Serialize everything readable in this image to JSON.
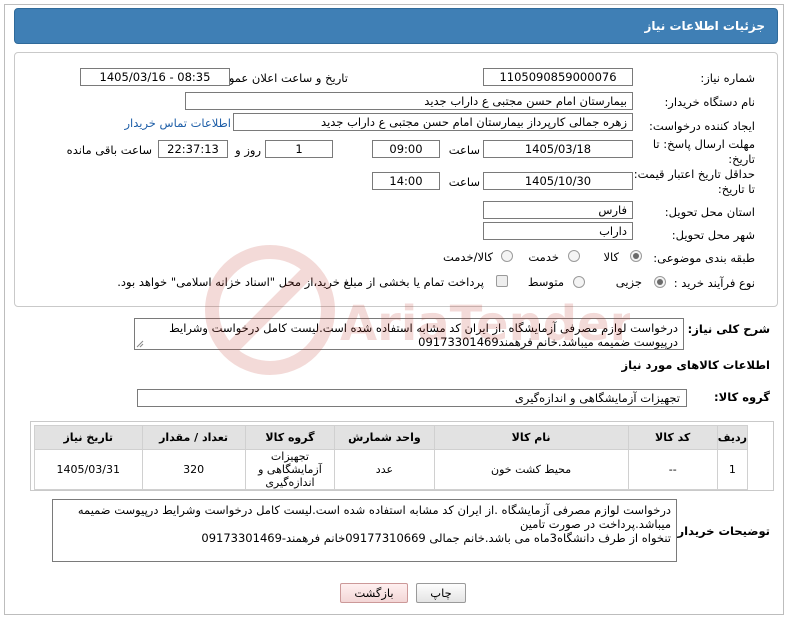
{
  "header": {
    "title": "جزئیات اطلاعات نیاز"
  },
  "form": {
    "need_number_label": "شماره نیاز:",
    "need_number": "1105090859000076",
    "announce_label": "تاریخ و ساعت اعلان عمومی:",
    "announce_value": "1405/03/16 - 08:35",
    "buyer_org_label": "نام دستگاه خریدار:",
    "buyer_org": "بیمارستان امام حسن مجتبی  ع  داراب جدید",
    "creator_label": "ایجاد کننده درخواست:",
    "creator": "زهره جمالی کارپرداز بیمارستان امام حسن مجتبی  ع  داراب جدید",
    "contact_link": "اطلاعات تماس خریدار",
    "deadline_label_1": "مهلت ارسال پاسخ: تا",
    "deadline_label_2": "تاریخ:",
    "deadline_date": "1405/03/18",
    "time_label": "ساعت",
    "deadline_time": "09:00",
    "days_value": "1",
    "days_label": "روز و",
    "remaining_time": "22:37:13",
    "remaining_label": "ساعت باقی مانده",
    "price_label_1": "حداقل تاریخ اعتبار قیمت:",
    "price_label_2": "تا تاریخ:",
    "price_date": "1405/10/30",
    "price_time": "14:00",
    "province_label": "استان محل تحویل:",
    "province": "فارس",
    "city_label": "شهر محل تحویل:",
    "city": "داراب",
    "category_label": "طبقه بندی موضوعی:",
    "category_options": [
      "کالا",
      "خدمت",
      "کالا/خدمت"
    ],
    "process_label": "نوع فرآیند خرید :",
    "process_options": [
      "جزیی",
      "متوسط"
    ],
    "payment_note": "پرداخت تمام یا بخشی از مبلغ خرید،از محل \"اسناد خزانه اسلامی\" خواهد بود."
  },
  "general_desc": {
    "label": "شرح کلی نیاز:",
    "line1": "درخواست لوازم مصرفی آزمایشگاه .از ایران کد مشابه استفاده شده است.لیست کامل درخواست وشرایط",
    "line2": "درپیوست ضمیمه میباشد.خانم فرهمند09173301469"
  },
  "goods": {
    "section_title": "اطلاعات کالاهای مورد نیاز",
    "group_label": "گروه کالا:",
    "group_value": "تجهیزات آزمایشگاهی و اندازه‌گیری",
    "columns": [
      "ردیف",
      "کد کالا",
      "نام کالا",
      "واحد شمارش",
      "گروه کالا",
      "تعداد / مقدار",
      "تاریخ نیاز"
    ],
    "rows": [
      {
        "row": "1",
        "code": "--",
        "name": "محیط کشت خون",
        "unit": "عدد",
        "group_l1": "تجهیزات",
        "group_l2": "آزمایشگاهی و",
        "group_l3": "اندازه‌گیری",
        "qty": "320",
        "date": "1405/03/31"
      }
    ]
  },
  "buyer_notes": {
    "label": "توضیحات خریدار:",
    "line1": "درخواست لوازم مصرفی آزمایشگاه .از ایران کد مشابه استفاده شده است.لیست کامل درخواست وشرایط درپیوست ضمیمه",
    "line2": "میباشد.پرداخت در صورت تامین",
    "line3": "تنخواه از طرف دانشگاه3ماه می باشد.خانم جمالی 09177310669خانم فرهمند-09173301469"
  },
  "buttons": {
    "print": "چاپ",
    "back": "بازگشت"
  },
  "watermark": {
    "text": "AriaTender.neT"
  },
  "colors": {
    "header": "#3f7fb5",
    "link": "#1f5fa8",
    "watermark": "#c0392b"
  }
}
